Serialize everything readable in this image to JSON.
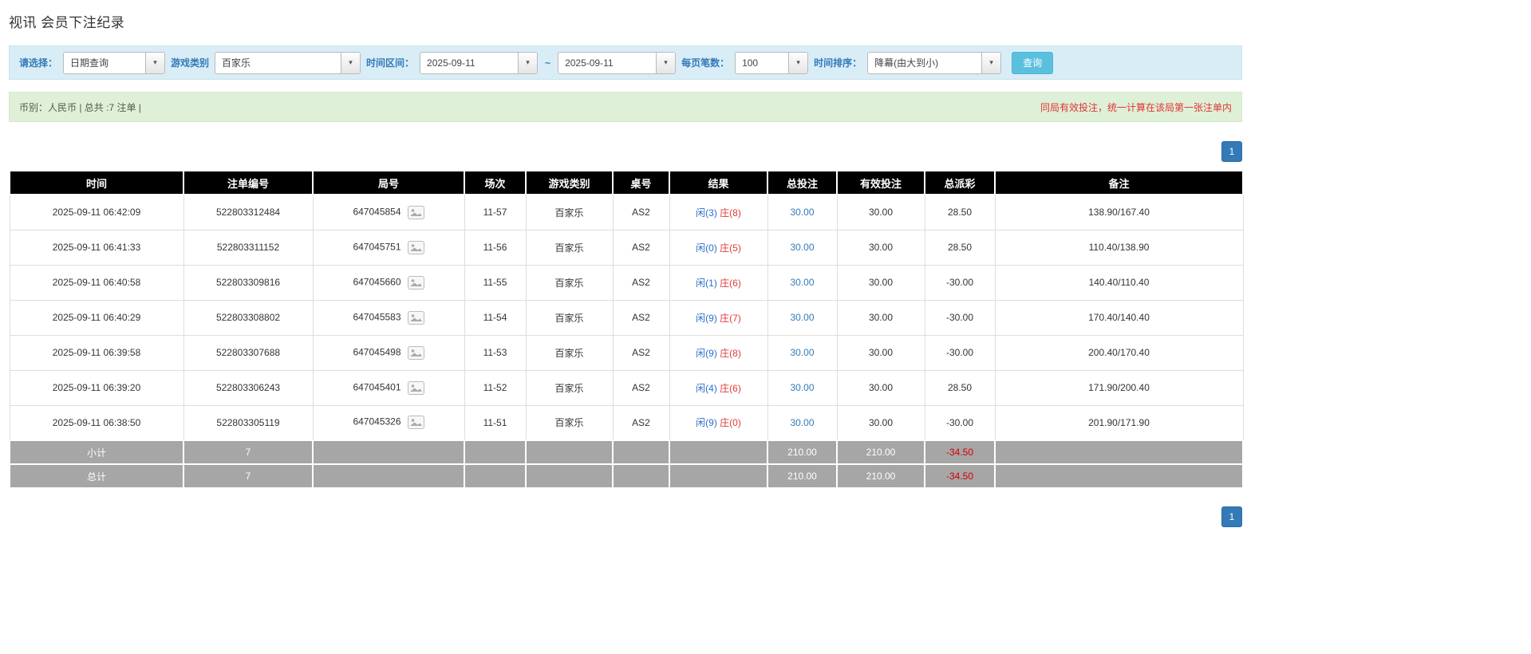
{
  "page": {
    "title": "视讯 会员下注纪录"
  },
  "filters": {
    "select_label": "请选择：",
    "select_value": "日期查询",
    "game_type_label": "游戏类别",
    "game_type_value": "百家乐",
    "date_range_label": "时间区间：",
    "date_from": "2025-09-11",
    "date_separator": "~",
    "date_to": "2025-09-11",
    "page_size_label": "每页笔数：",
    "page_size_value": "100",
    "sort_label": "时间排序：",
    "sort_value": "降幕(由大到小)",
    "search_button": "查询"
  },
  "info_bar": {
    "left": "币别：人民币 | 总共 :7 注单 |",
    "right": "同局有效投注，统一计算在该局第一张注单内"
  },
  "pagination": {
    "page": "1"
  },
  "icons": {
    "dropdown": "caret-down-icon",
    "round_detail": "video-image-icon"
  },
  "colors": {
    "accent_blue": "#337ab7",
    "player_blue": "#2a6fc9",
    "banker_red": "#e03b3b",
    "danger_red": "#e03b3b",
    "header_bg": "#000000",
    "summary_bg": "#a6a6a6",
    "filter_bg": "#d9edf7",
    "info_bg": "#dff0d8",
    "search_button_bg": "#5bc0de"
  },
  "table": {
    "headers": [
      "时间",
      "注单编号",
      "局号",
      "场次",
      "游戏类别",
      "桌号",
      "结果",
      "总投注",
      "有效投注",
      "总派彩",
      "备注"
    ],
    "rows": [
      {
        "time": "2025-09-11 06:42:09",
        "bet_id": "522803312484",
        "round_id": "647045854",
        "session": "11-57",
        "game": "百家乐",
        "table_no": "AS2",
        "player": "闲(3)",
        "banker": "庄(8)",
        "total_bet": "30.00",
        "valid_bet": "30.00",
        "payout": "28.50",
        "remark": "138.90/167.40"
      },
      {
        "time": "2025-09-11 06:41:33",
        "bet_id": "522803311152",
        "round_id": "647045751",
        "session": "11-56",
        "game": "百家乐",
        "table_no": "AS2",
        "player": "闲(0)",
        "banker": "庄(5)",
        "total_bet": "30.00",
        "valid_bet": "30.00",
        "payout": "28.50",
        "remark": "110.40/138.90"
      },
      {
        "time": "2025-09-11 06:40:58",
        "bet_id": "522803309816",
        "round_id": "647045660",
        "session": "11-55",
        "game": "百家乐",
        "table_no": "AS2",
        "player": "闲(1)",
        "banker": "庄(6)",
        "total_bet": "30.00",
        "valid_bet": "30.00",
        "payout": "-30.00",
        "remark": "140.40/110.40"
      },
      {
        "time": "2025-09-11 06:40:29",
        "bet_id": "522803308802",
        "round_id": "647045583",
        "session": "11-54",
        "game": "百家乐",
        "table_no": "AS2",
        "player": "闲(9)",
        "banker": "庄(7)",
        "total_bet": "30.00",
        "valid_bet": "30.00",
        "payout": "-30.00",
        "remark": "170.40/140.40"
      },
      {
        "time": "2025-09-11 06:39:58",
        "bet_id": "522803307688",
        "round_id": "647045498",
        "session": "11-53",
        "game": "百家乐",
        "table_no": "AS2",
        "player": "闲(9)",
        "banker": "庄(8)",
        "total_bet": "30.00",
        "valid_bet": "30.00",
        "payout": "-30.00",
        "remark": "200.40/170.40"
      },
      {
        "time": "2025-09-11 06:39:20",
        "bet_id": "522803306243",
        "round_id": "647045401",
        "session": "11-52",
        "game": "百家乐",
        "table_no": "AS2",
        "player": "闲(4)",
        "banker": "庄(6)",
        "total_bet": "30.00",
        "valid_bet": "30.00",
        "payout": "28.50",
        "remark": "171.90/200.40"
      },
      {
        "time": "2025-09-11 06:38:50",
        "bet_id": "522803305119",
        "round_id": "647045326",
        "session": "11-51",
        "game": "百家乐",
        "table_no": "AS2",
        "player": "闲(9)",
        "banker": "庄(0)",
        "total_bet": "30.00",
        "valid_bet": "30.00",
        "payout": "-30.00",
        "remark": "201.90/171.90"
      }
    ],
    "subtotal": {
      "label": "小计",
      "count": "7",
      "total_bet": "210.00",
      "valid_bet": "210.00",
      "payout": "-34.50"
    },
    "total": {
      "label": "总计",
      "count": "7",
      "total_bet": "210.00",
      "valid_bet": "210.00",
      "payout": "-34.50"
    }
  }
}
